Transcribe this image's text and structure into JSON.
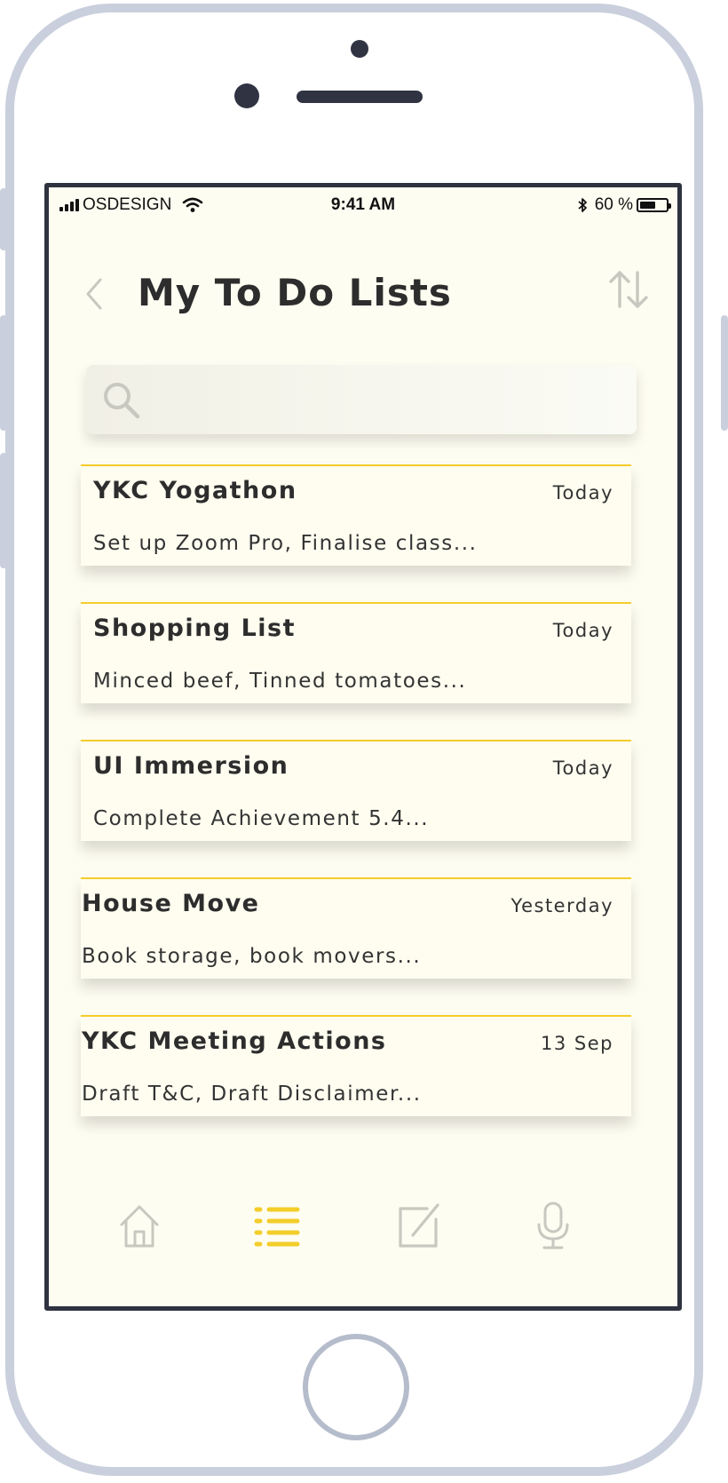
{
  "status_bar": {
    "carrier": "OSDESIGN",
    "time": "9:41 AM",
    "battery": "60 %",
    "battery_level": 0.6
  },
  "header": {
    "title": "My To Do Lists",
    "back_icon": "chevron-left-icon",
    "sort_icon": "sort-arrows-icon"
  },
  "search": {
    "placeholder": "",
    "value": ""
  },
  "lists": [
    {
      "title": "YKC Yogathon",
      "date": "Today",
      "preview": "Set up Zoom Pro, Finalise class..."
    },
    {
      "title": "Shopping List",
      "date": "Today",
      "preview": "Minced beef, Tinned tomatoes..."
    },
    {
      "title": "UI Immersion",
      "date": "Today",
      "preview": "Complete Achievement 5.4..."
    },
    {
      "title": "House Move",
      "date": "Yesterday",
      "preview": "Book storage, book movers..."
    },
    {
      "title": "YKC Meeting Actions",
      "date": "13 Sep",
      "preview": "Draft T&C, Draft Disclaimer..."
    }
  ],
  "tab_bar": {
    "items": [
      {
        "icon": "home-icon",
        "active": false
      },
      {
        "icon": "list-icon",
        "active": true
      },
      {
        "icon": "edit-icon",
        "active": false
      },
      {
        "icon": "microphone-icon",
        "active": false
      }
    ]
  },
  "colors": {
    "accent": "#f3cd2a",
    "background": "#fefdf1",
    "text": "#2d2d2d",
    "icon_inactive": "#c8c8c0",
    "frame": "#c9cfdc"
  }
}
